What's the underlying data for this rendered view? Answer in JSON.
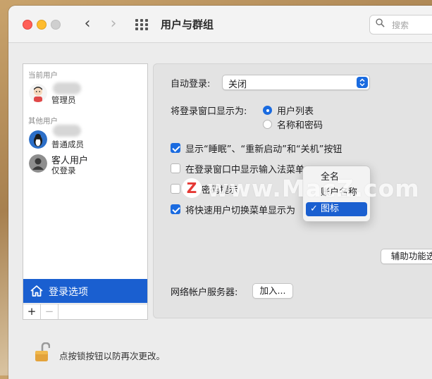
{
  "window": {
    "title": "用户与群组",
    "search_placeholder": "搜索"
  },
  "sidebar": {
    "current_users_label": "当前用户",
    "current_user_role": "管理员",
    "other_users_label": "其他用户",
    "other_users": [
      {
        "name": "",
        "role": "普通成员"
      },
      {
        "name": "客人用户",
        "role": "仅登录"
      }
    ],
    "login_options_label": "登录选项",
    "add_label": "+",
    "remove_label": "−"
  },
  "panel": {
    "auto_login_label": "自动登录:",
    "auto_login_value": "关闭",
    "display_window_label": "将登录窗口显示为:",
    "display_options": [
      {
        "label": "用户列表",
        "selected": true
      },
      {
        "label": "名称和密码",
        "selected": false
      }
    ],
    "checkboxes": [
      {
        "label": "显示“睡眠”、“重新启动”和“关机”按钮",
        "checked": true
      },
      {
        "label": "在登录窗口中显示输入法菜单",
        "checked": false
      },
      {
        "label": "密码提示",
        "checked": false
      },
      {
        "label": "将快速用户切换菜单显示为",
        "checked": true
      }
    ],
    "accessibility_button": "辅助功能选",
    "network_server_label": "网络帐户服务器:",
    "join_button": "加入..."
  },
  "popup_menu": {
    "items": [
      {
        "label": "全名",
        "selected": false
      },
      {
        "label": "账户名称",
        "selected": false
      },
      {
        "label": "图标",
        "selected": true
      }
    ],
    "check_glyph": "✓"
  },
  "footer": {
    "lock_text": "点按锁按钮以防再次更改。"
  },
  "watermark": {
    "logo_letter": "Z",
    "text": "www.MacZ.com"
  },
  "colors": {
    "accent": "#1a5fd0",
    "selection_blue": "#1a6be0",
    "window_bg": "#ececec"
  }
}
